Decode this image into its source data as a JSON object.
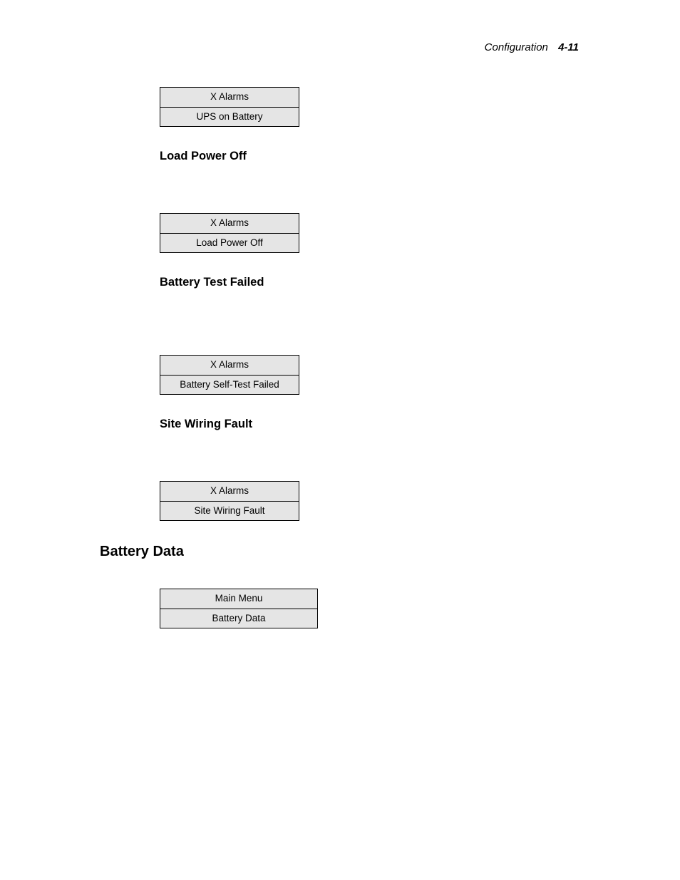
{
  "header": {
    "section_name": "Configuration",
    "page_number": "4-11"
  },
  "blocks": {
    "first_lcd": {
      "line1": "X Alarms",
      "line2": "UPS on Battery"
    },
    "heading1": "Load Power Off",
    "second_lcd": {
      "line1": "X Alarms",
      "line2": "Load Power Off"
    },
    "heading2": "Battery Test Failed",
    "third_lcd": {
      "line1": "X Alarms",
      "line2": "Battery Self-Test Failed"
    },
    "heading3": "Site Wiring Fault",
    "fourth_lcd": {
      "line1": "X Alarms",
      "line2": "Site Wiring Fault"
    },
    "main_heading": "Battery Data",
    "fifth_lcd": {
      "line1": "Main Menu",
      "line2": "Battery Data"
    }
  }
}
